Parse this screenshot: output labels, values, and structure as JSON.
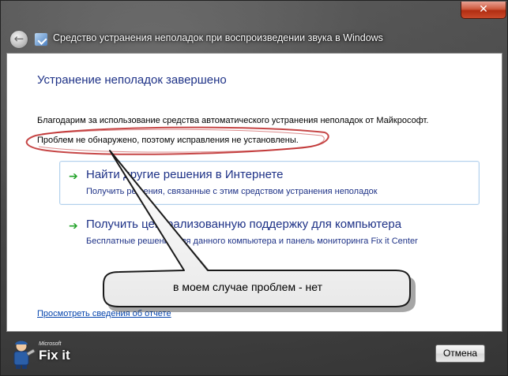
{
  "window": {
    "title": "Средство устранения неполадок при воспроизведении звука в Windows",
    "close_label": "✕",
    "back_label": "←"
  },
  "content": {
    "heading": "Устранение неполадок завершено",
    "thanks": "Благодарим за использование средства автоматического устранения неполадок от Майкрософт.",
    "result": "Проблем не обнаружено, поэтому исправления не установлены."
  },
  "options": [
    {
      "title": "Найти другие решения в Интернете",
      "description": "Получить решения, связанные с этим средством устранения неполадок"
    },
    {
      "title": "Получить централизованную поддержку для компьютера",
      "description": "Бесплатные решения для данного компьютера и панель мониторинга Fix it Center"
    }
  ],
  "report_link": "Просмотреть сведения об отчете",
  "annotation": {
    "callout_text": "в моем случае проблем - нет",
    "ellipse_color": "#b81818"
  },
  "footer": {
    "logo_small": "Microsoft",
    "logo_main": "Fix it",
    "cancel_label": "Отмена"
  },
  "icons": {
    "option_arrow": "green-arrow-icon"
  }
}
